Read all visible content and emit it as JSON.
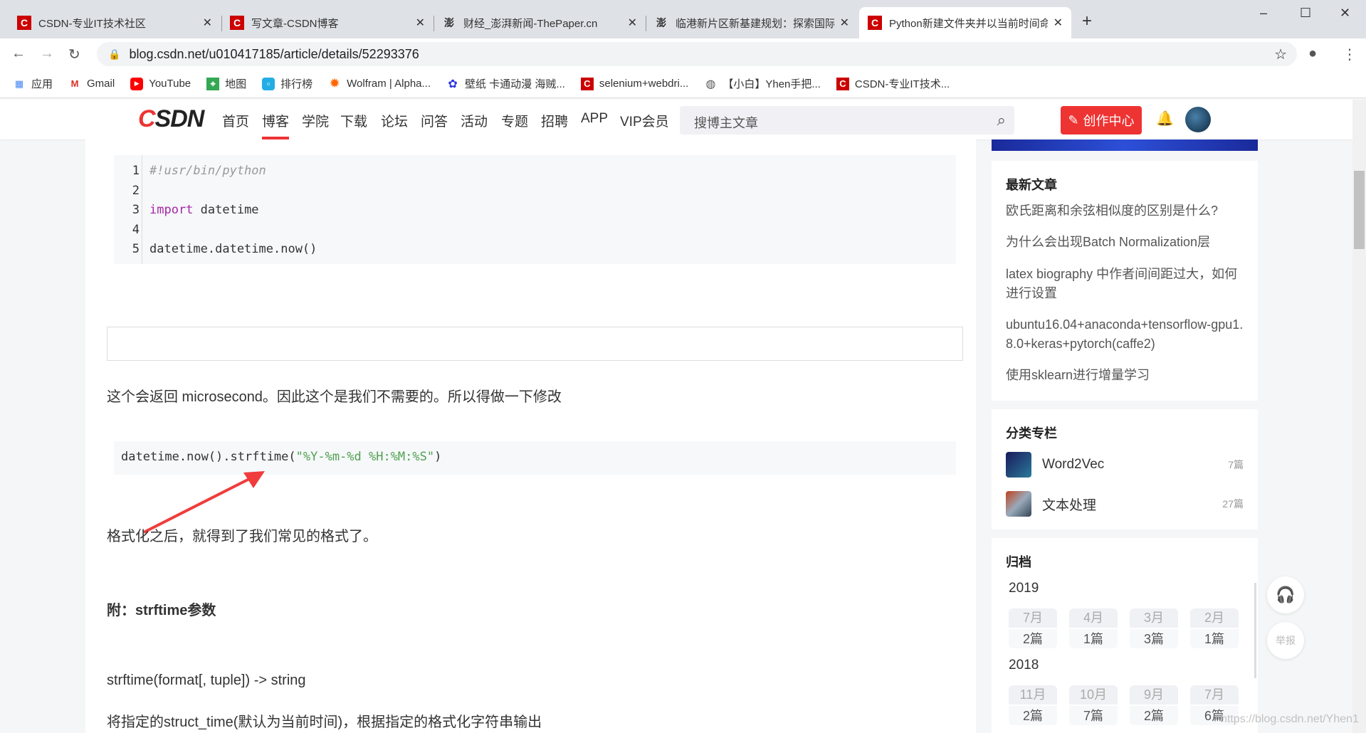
{
  "browser": {
    "tabs": [
      {
        "title": "CSDN-专业IT技术社区",
        "icon": "csdn-icon"
      },
      {
        "title": "写文章-CSDN博客",
        "icon": "csdn-icon"
      },
      {
        "title": "财经_澎湃新闻-ThePaper.cn",
        "icon": "thepaper-icon"
      },
      {
        "title": "临港新片区新基建规划：探索国际",
        "icon": "thepaper-icon"
      },
      {
        "title": "Python新建文件夹并以当前时间命名",
        "icon": "csdn-icon",
        "active": true
      }
    ],
    "url": "blog.csdn.net/u010417185/article/details/52293376",
    "bookmarks": [
      {
        "label": "应用",
        "icon": "apps-icon"
      },
      {
        "label": "Gmail",
        "icon": "gmail-icon"
      },
      {
        "label": "YouTube",
        "icon": "youtube-icon"
      },
      {
        "label": "地图",
        "icon": "maps-icon"
      },
      {
        "label": "排行榜",
        "icon": "bilibili-icon"
      },
      {
        "label": "Wolfram | Alpha...",
        "icon": "wolfram-icon"
      },
      {
        "label": "壁纸 卡通动漫 海贼...",
        "icon": "baidu-icon"
      },
      {
        "label": "selenium+webdri...",
        "icon": "csdn-icon"
      },
      {
        "label": "【小白】Yhen手把...",
        "icon": "globe-icon"
      },
      {
        "label": "CSDN-专业IT技术...",
        "icon": "csdn-icon"
      }
    ]
  },
  "header": {
    "logo": "CSDN",
    "nav": [
      "首页",
      "博客",
      "学院",
      "下载",
      "论坛",
      "问答",
      "活动",
      "专题",
      "招聘",
      "APP",
      "VIP会员"
    ],
    "active_nav": "博客",
    "search_placeholder": "搜博主文章",
    "create_label": "创作中心",
    "accent": "#e33e33"
  },
  "article": {
    "code1": {
      "lines": [
        "1",
        "2",
        "3",
        "4",
        "5"
      ],
      "l1": "#!usr/bin/python",
      "kw": "import",
      "l3rest": " datetime",
      "l5": "datetime.datetime.now()"
    },
    "p1": "这个会返回 microsecond。因此这个是我们不需要的。所以得做一下修改",
    "code2": {
      "pre": "datetime.now().strftime(",
      "str": "\"%Y-%m-%d %H:%M:%S\"",
      "post": ")"
    },
    "p2": "格式化之后，就得到了我们常见的格式了。",
    "h": "附：strftime参数",
    "p3": "strftime(format[, tuple]) -> string",
    "p4": "将指定的struct_time(默认为当前时间)，根据指定的格式化字符串输出"
  },
  "sidebar": {
    "recent_title": "最新文章",
    "recent": [
      "欧氏距离和余弦相似度的区别是什么?",
      "为什么会出现Batch Normalization层",
      "latex biography 中作者间间距过大，如何进行设置",
      "ubuntu16.04+anaconda+tensorflow-gpu1.8.0+keras+pytorch(caffe2)",
      "使用sklearn进行增量学习"
    ],
    "columns_title": "分类专栏",
    "columns": [
      {
        "name": "Word2Vec",
        "count": "7篇"
      },
      {
        "name": "文本处理",
        "count": "27篇"
      }
    ],
    "archive_title": "归档",
    "archive": [
      {
        "year": "2019",
        "months": [
          {
            "m": "7月",
            "c": "2篇"
          },
          {
            "m": "4月",
            "c": "1篇"
          },
          {
            "m": "3月",
            "c": "3篇"
          },
          {
            "m": "2月",
            "c": "1篇"
          }
        ]
      },
      {
        "year": "2018",
        "months": [
          {
            "m": "11月",
            "c": "2篇"
          },
          {
            "m": "10月",
            "c": "7篇"
          },
          {
            "m": "9月",
            "c": "2篇"
          },
          {
            "m": "7月",
            "c": "6篇"
          }
        ]
      }
    ]
  },
  "float": {
    "report": "举报"
  },
  "watermark": "https://blog.csdn.net/Yhen1"
}
